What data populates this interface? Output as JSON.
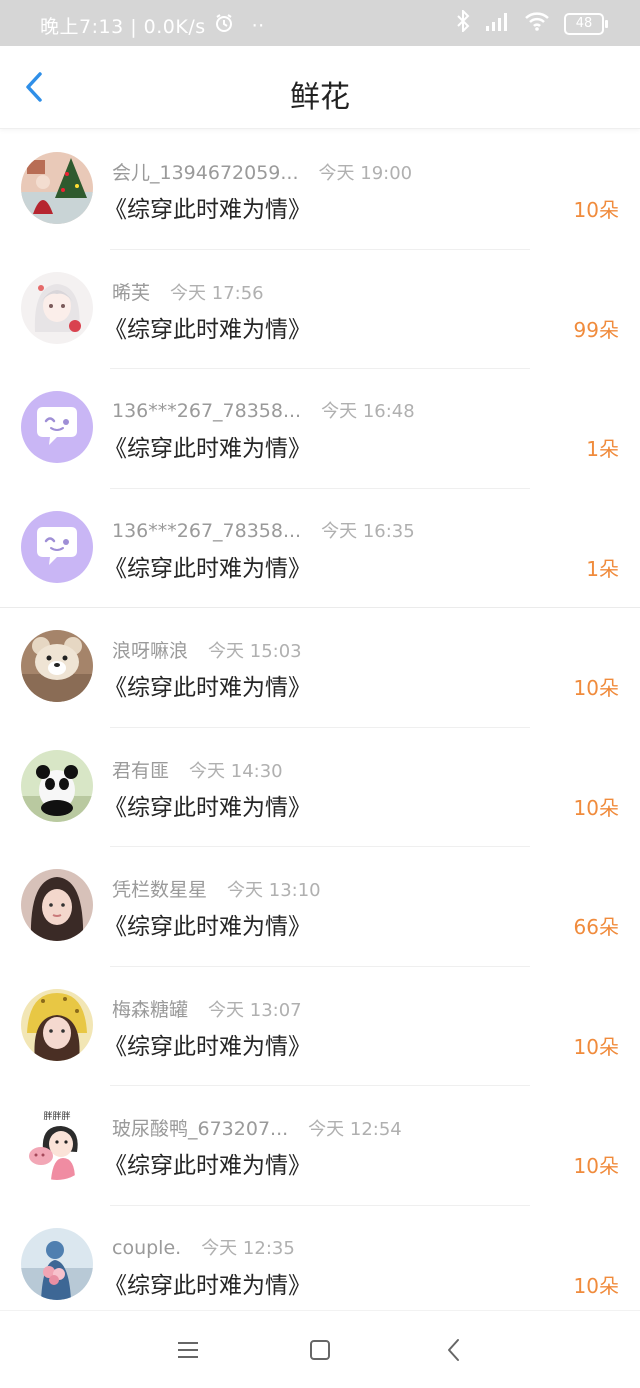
{
  "status_bar": {
    "time_text": "晚上7:13 | 0.0K/s",
    "dots": "··",
    "battery": "48"
  },
  "nav": {
    "title": "鲜花"
  },
  "rows": [
    {
      "name": "会儿_1394672059...",
      "time": "今天 19:00",
      "book": "《综穿此时难为情》",
      "count": "10朵"
    },
    {
      "name": "晞芙",
      "time": "今天 17:56",
      "book": "《综穿此时难为情》",
      "count": "99朵"
    },
    {
      "name": "136***267_78358...",
      "time": "今天 16:48",
      "book": "《综穿此时难为情》",
      "count": "1朵"
    },
    {
      "name": "136***267_78358...",
      "time": "今天 16:35",
      "book": "《综穿此时难为情》",
      "count": "1朵"
    },
    {
      "name": "浪呀嘛浪",
      "time": "今天 15:03",
      "book": "《综穿此时难为情》",
      "count": "10朵"
    },
    {
      "name": "君有匪",
      "time": "今天 14:30",
      "book": "《综穿此时难为情》",
      "count": "10朵"
    },
    {
      "name": "凭栏数星星",
      "time": "今天 13:10",
      "book": "《综穿此时难为情》",
      "count": "66朵"
    },
    {
      "name": "梅森糖罐",
      "time": "今天 13:07",
      "book": "《综穿此时难为情》",
      "count": "10朵"
    },
    {
      "name": "玻尿酸鸭_673207...",
      "time": "今天 12:54",
      "book": "《综穿此时难为情》",
      "count": "10朵"
    },
    {
      "name": "couple.",
      "time": "今天 12:35",
      "book": "《综穿此时难为情》",
      "count": "10朵"
    }
  ],
  "avatar_caption": "胖胖胖",
  "colors": {
    "accent": "#2f8fe8",
    "count": "#f08b3c",
    "default_avatar": "#c9b6f5"
  }
}
